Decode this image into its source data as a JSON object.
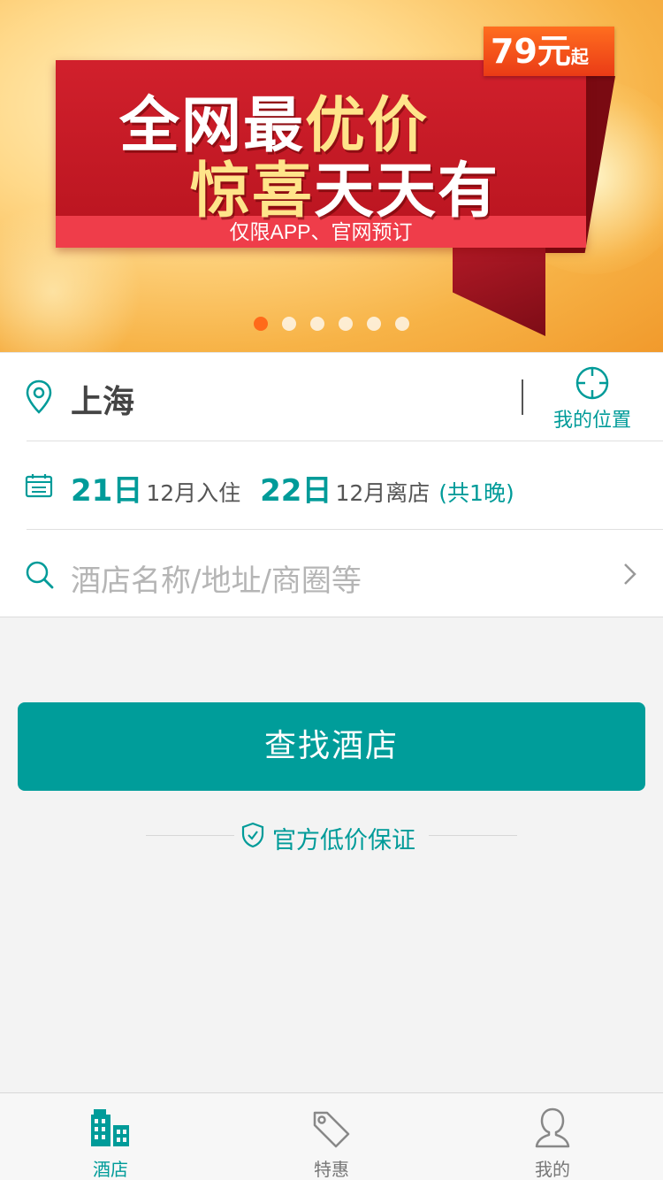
{
  "banner": {
    "headline_line1_white": "全网最",
    "headline_line1_gold": "优价",
    "headline_line2_gold": "惊喜",
    "headline_line2_white": "天天有",
    "subtitle": "仅限APP、官网预订",
    "price": "79元",
    "price_suffix": "起",
    "slide_count": 6,
    "active_slide": 1
  },
  "search": {
    "city": "上海",
    "my_location_label": "我的位置",
    "checkin_day": "21日",
    "checkin_month": "12月入住",
    "checkout_day": "22日",
    "checkout_month": "12月离店",
    "nights": "(共1晚)",
    "keyword_placeholder": "酒店名称/地址/商圈等"
  },
  "actions": {
    "find_hotel_label": "查找酒店",
    "guarantee_label": "官方低价保证"
  },
  "tabbar": {
    "tabs": [
      {
        "label": "酒店",
        "icon": "hotel-building-icon",
        "active": true
      },
      {
        "label": "特惠",
        "icon": "tag-icon",
        "active": false
      },
      {
        "label": "我的",
        "icon": "user-icon",
        "active": false
      }
    ]
  },
  "colors": {
    "accent": "#009d9a",
    "banner_red": "#c8161f",
    "dot_active": "#ff6a1a"
  }
}
